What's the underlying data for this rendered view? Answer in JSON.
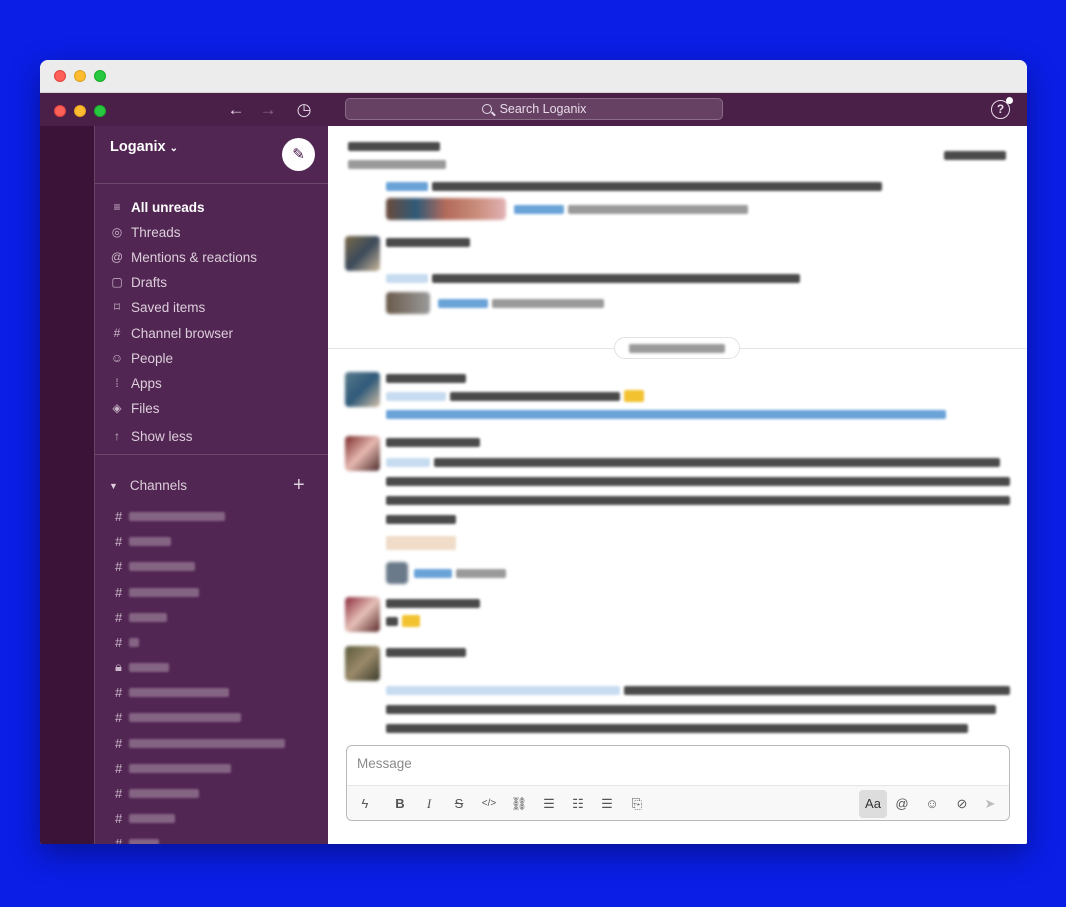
{
  "workspace": {
    "name": "Loganix"
  },
  "search": {
    "placeholder": "Search Loganix"
  },
  "topbar": {
    "back_icon": "←",
    "forward_icon": "→",
    "history_icon": "◷",
    "help_icon": "?"
  },
  "nav": {
    "items": [
      {
        "label": "All unreads",
        "icon": "≡",
        "bold": true
      },
      {
        "label": "Threads",
        "icon": "◎"
      },
      {
        "label": "Mentions & reactions",
        "icon": "@"
      },
      {
        "label": "Drafts",
        "icon": "▢"
      },
      {
        "label": "Saved items",
        "icon": "⌑"
      },
      {
        "label": "Channel browser",
        "icon": "#"
      },
      {
        "label": "People",
        "icon": "☺"
      },
      {
        "label": "Apps",
        "icon": "⁞"
      },
      {
        "label": "Files",
        "icon": "◈"
      },
      {
        "label": "Show less",
        "icon": "↑"
      }
    ]
  },
  "channels": {
    "title": "Channels",
    "add_icon": "+"
  },
  "composer": {
    "placeholder": "Message",
    "format_label": "Aa"
  },
  "colors": {
    "sidebar": "#522653",
    "topbar": "#4a1f48",
    "accent": "#1264a3",
    "background": "#0a1ee6"
  }
}
